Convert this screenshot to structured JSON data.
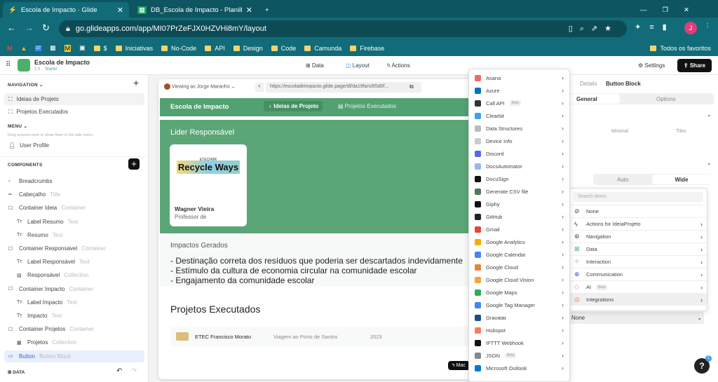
{
  "browser": {
    "tabs": [
      {
        "title": "Escola de Impacto · Glide"
      },
      {
        "title": "DB_Escola de Impacto - Planilha"
      }
    ],
    "url": "go.glideapps.com/app/MI07PrZeFJX0HZVHi8mY/layout",
    "profile_initial": "J",
    "bookmarks": [
      "$",
      "Iniciativas",
      "No-Code",
      "API",
      "Design",
      "Code",
      "Camunda",
      "Firebase"
    ],
    "all_bookmarks": "Todos os favoritos",
    "bookmark_icon_label": "27"
  },
  "app": {
    "name": "Escola de Impacto",
    "version": "2.5",
    "plan": "Starter",
    "nav_tabs": [
      "Data",
      "Layout",
      "Actions"
    ],
    "settings": "Settings",
    "share": "Share"
  },
  "sidebar": {
    "navigation_label": "NAVIGATION",
    "nav_items": [
      "Ideias de Projeto",
      "Projetos Executados"
    ],
    "menu_label": "MENU",
    "menu_hint": "Drag screens here to show them in the side menu.",
    "menu_items": [
      "User Profile"
    ],
    "components_label": "COMPONENTS",
    "components": [
      {
        "name": "Breadcrumbs",
        "type": ""
      },
      {
        "name": "Cabeçalho",
        "type": "Title"
      },
      {
        "name": "Container Ideia",
        "type": "Container"
      },
      {
        "name": "Label Resumo",
        "type": "Text"
      },
      {
        "name": "Resumo",
        "type": "Text"
      },
      {
        "name": "Container Responsável",
        "type": "Container"
      },
      {
        "name": "Label Responsável",
        "type": "Text"
      },
      {
        "name": "Responsável",
        "type": "Collection"
      },
      {
        "name": "Container Impacto",
        "type": "Container"
      },
      {
        "name": "Label Impacto",
        "type": "Text"
      },
      {
        "name": "Impacto",
        "type": "Text"
      },
      {
        "name": "Container Projetos",
        "type": "Container"
      },
      {
        "name": "Projetos",
        "type": "Collection"
      },
      {
        "name": "Button",
        "type": "Button Block"
      }
    ],
    "data_label": "DATA"
  },
  "preview": {
    "viewing_as": "Viewing as Jorge Maranho",
    "url": "https://escoladeimpacto.glide.page/dl/da19fa/s/85d0f...",
    "app_title": "Escola de Impacto",
    "tabs": [
      "Ideias de Projeto",
      "Projetos Executados"
    ],
    "lider_label": "Lider Responsável",
    "person_name": "Wagner Vieira",
    "person_role": "Professor de",
    "logo_text": "Recycle Ways",
    "logo_small": "ETECFMR",
    "impactos_label": "Impactos Gerados",
    "impactos": [
      "- Destinação correta dos resíduos que poderia ser descartados indevidamente",
      "- Estímulo da cultura de economia circular na comunidade escolar",
      "- Engajamento da comunidade escolar"
    ],
    "projetos_title": "Projetos Executados",
    "projetos": [
      {
        "school": "ETEC Francisco Morato",
        "name": "Viagem ao Porto de Santos",
        "year": "2023"
      }
    ],
    "action_button": "Mac"
  },
  "integrations": [
    {
      "label": "Asana",
      "color": "#f06a6a"
    },
    {
      "label": "Azure",
      "color": "#0072c6"
    },
    {
      "label": "Call API",
      "color": "#333",
      "beta": "Beta"
    },
    {
      "label": "Clearbit",
      "color": "#3aa0f3"
    },
    {
      "label": "Data Structures",
      "color": "#bbb"
    },
    {
      "label": "Device Info",
      "color": "#ccc"
    },
    {
      "label": "Discord",
      "color": "#5865f2"
    },
    {
      "label": "DocsAutomator",
      "color": "#9ab6f0"
    },
    {
      "label": "DocuSign",
      "color": "#111"
    },
    {
      "label": "Generate CSV file",
      "color": "#4a7c59"
    },
    {
      "label": "Giphy",
      "color": "#111"
    },
    {
      "label": "GitHub",
      "color": "#222"
    },
    {
      "label": "Gmail",
      "color": "#ea4335"
    },
    {
      "label": "Google Analytics",
      "color": "#f9ab00"
    },
    {
      "label": "Google Calendar",
      "color": "#4285f4"
    },
    {
      "label": "Google Cloud",
      "color": "#ea8335"
    },
    {
      "label": "Google Cloud Vision",
      "color": "#f4a340"
    },
    {
      "label": "Google Maps",
      "color": "#34a853"
    },
    {
      "label": "Google Tag Manager",
      "color": "#4285f4"
    },
    {
      "label": "Gravatar",
      "color": "#1e4b8f"
    },
    {
      "label": "Hubspot",
      "color": "#ff7a59"
    },
    {
      "label": "IFTTT Webhook",
      "color": "#111"
    },
    {
      "label": "JSON",
      "color": "#888",
      "beta": "Beta"
    },
    {
      "label": "Microsoft Outlook",
      "color": "#0078d4"
    }
  ],
  "right_panel": {
    "breadcrumb": [
      "Details",
      "Button Block"
    ],
    "tabs": [
      "General",
      "Options"
    ],
    "styles": [
      "Minimal",
      "Tiles"
    ],
    "width_options": [
      "Auto",
      "Wide"
    ],
    "search_placeholder": "Search items",
    "menu": [
      {
        "label": "None"
      },
      {
        "label": "Actions for IdeiaProjeto"
      },
      {
        "label": "Navigation"
      },
      {
        "label": "Data"
      },
      {
        "label": "Interaction"
      },
      {
        "label": "Communication"
      },
      {
        "label": "AI",
        "beta": "Beta"
      },
      {
        "label": "Integrations"
      }
    ],
    "select_value": "None",
    "help_badge": "1"
  }
}
